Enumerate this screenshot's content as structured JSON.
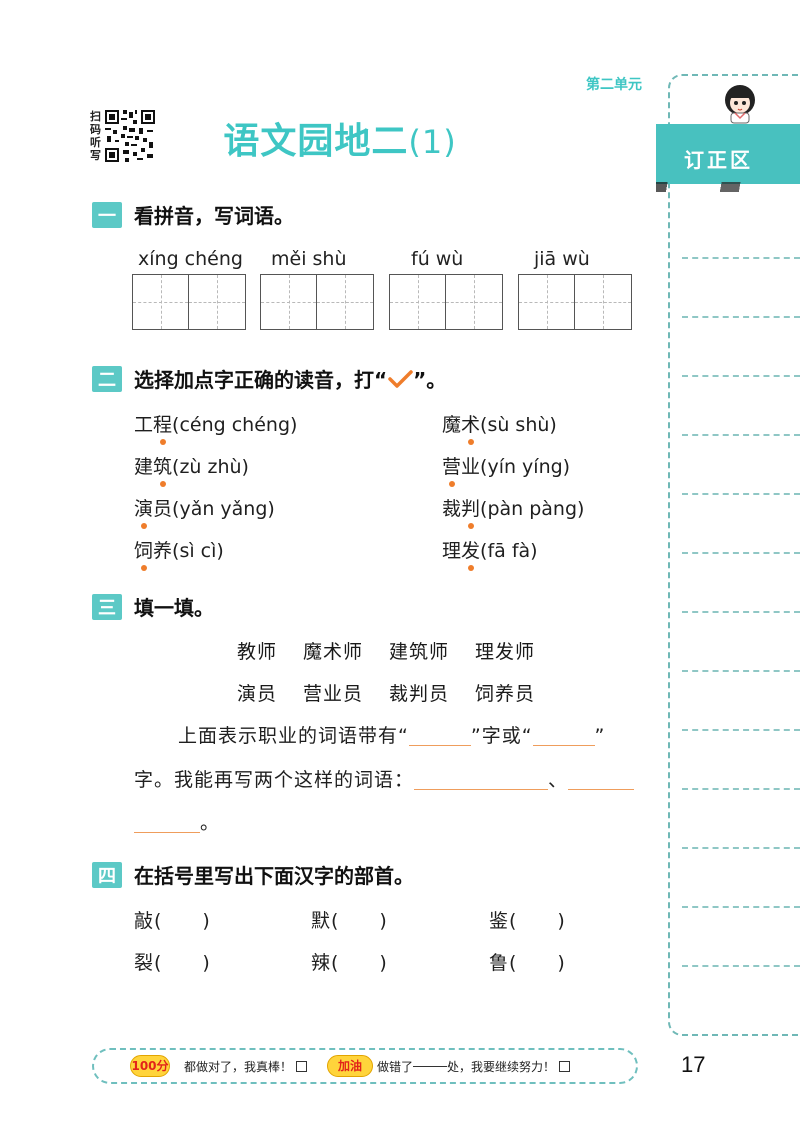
{
  "header": {
    "unit": "第二单元",
    "qr_text": [
      "扫",
      "码",
      "听",
      "写"
    ],
    "title_main": "语文园地二",
    "title_paren": "(1)"
  },
  "correction_area": {
    "label": "订正区"
  },
  "section1": {
    "badge": "一",
    "title": "看拼音，写词语。",
    "items": [
      {
        "pinyin": "xíng chéng",
        "cells": 2
      },
      {
        "pinyin": "měi shù",
        "cells": 2
      },
      {
        "pinyin": "fú wù",
        "cells": 2
      },
      {
        "pinyin": "jiā wù",
        "cells": 2
      }
    ]
  },
  "section2": {
    "badge": "二",
    "title_before": "选择加点字正确的读音，打“",
    "title_after": "”。",
    "items": [
      {
        "a": "工",
        "b": "程",
        "reading": "(céng  chéng)",
        "dot": "b"
      },
      {
        "a": "魔",
        "b": "术",
        "reading": "(sù  shù)",
        "dot": "b"
      },
      {
        "a": "建",
        "b": "筑",
        "reading": "(zù  zhù)",
        "dot": "b"
      },
      {
        "a": "营",
        "b": "业",
        "reading": "(yín  yíng)",
        "dot": "a"
      },
      {
        "a": "演",
        "b": "员",
        "reading": "(yǎn  yǎng)",
        "dot": "a"
      },
      {
        "a": "裁",
        "b": "判",
        "reading": "(pàn  pàng)",
        "dot": "b"
      },
      {
        "a": "饲",
        "b": "养",
        "reading": "(sì  cì)",
        "dot": "a"
      },
      {
        "a": "理",
        "b": "发",
        "reading": "(fā  fà)",
        "dot": "b"
      }
    ]
  },
  "section3": {
    "badge": "三",
    "title": "填一填。",
    "words_row1": [
      "教师",
      "魔术师",
      "建筑师",
      "理发师"
    ],
    "words_row2": [
      "演员",
      "营业员",
      "裁判员",
      "饲养员"
    ],
    "line1_a": "上面表示职业的词语带有“",
    "line1_b": "”字或“",
    "line1_c": "”",
    "line2": "字。我能再写两个这样的词语：",
    "line2_sep": "、",
    "line3_end": "。"
  },
  "section4": {
    "badge": "四",
    "title": "在括号里写出下面汉字的部首。",
    "items": [
      "敲(　　)",
      "默(　　)",
      "鉴(　　)",
      "裂(　　)",
      "辣(　　)",
      "鲁(　　)"
    ]
  },
  "footer": {
    "score_badge": "100分",
    "text_all_right": "都做对了，我真棒！",
    "cheer_badge": "加油",
    "text_wrong_a": "做错了",
    "text_wrong_b": "处，我要继续努力！"
  },
  "page_number": "17"
}
